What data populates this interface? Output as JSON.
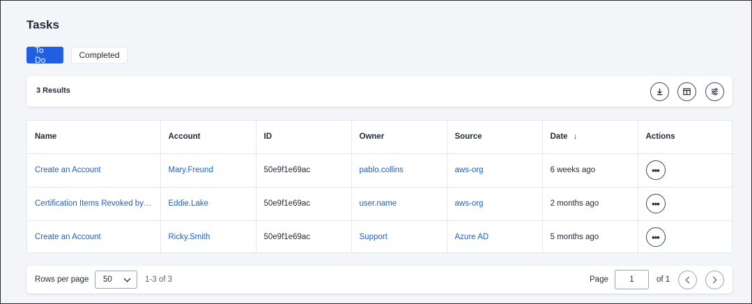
{
  "page": {
    "title": "Tasks"
  },
  "tabs": [
    {
      "label": "To Do",
      "active": true
    },
    {
      "label": "Completed",
      "active": false
    }
  ],
  "results": {
    "label": "3 Results",
    "icons": [
      "download-icon",
      "columns-icon",
      "filter-settings-icon"
    ]
  },
  "table": {
    "columns": [
      "Name",
      "Account",
      "ID",
      "Owner",
      "Source",
      "Date",
      "Actions"
    ],
    "sort_column": "Date",
    "sort_direction": "descending",
    "sort_glyph": "↓",
    "rows": [
      {
        "name": "Create an Account",
        "account": "Mary.Freund",
        "id": "50e9f1e69ac",
        "owner": "pablo.collins",
        "source": "aws-org",
        "date": "6 weeks ago",
        "action": "•••"
      },
      {
        "name": "Certification Items Revoked by…",
        "account": "Eddie.Lake",
        "id": "50e9f1e69ac",
        "owner": "user.name",
        "source": "aws-org",
        "date": "2 months ago",
        "action": "•••"
      },
      {
        "name": "Create an Account",
        "account": "Ricky.Smith",
        "id": "50e9f1e69ac",
        "owner": "Support",
        "source": "Azure AD",
        "date": "5 months ago",
        "action": "•••"
      }
    ]
  },
  "pagination": {
    "rows_per_page_label": "Rows per page",
    "rows_per_page_value": "50",
    "range_text": "1-3 of 3",
    "page_label": "Page",
    "page_value": "1",
    "of_label": "of 1"
  },
  "colors": {
    "accent": "#1f5fe0",
    "link": "#1f5fc4",
    "background": "#f3f5f8"
  }
}
